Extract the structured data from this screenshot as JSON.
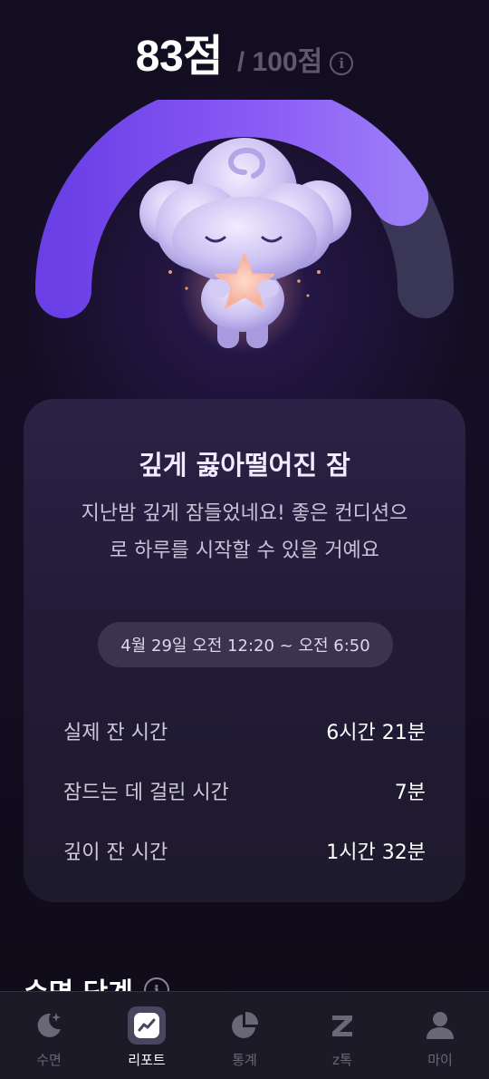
{
  "score": {
    "value": "83점",
    "max": "/ 100점",
    "score_fraction": 0.83
  },
  "card": {
    "title": "깊게 곯아떨어진 잠",
    "description": "지난밤 깊게 잠들었네요! 좋은 컨디션으로 하루를 시작할 수 있을 거예요",
    "time_range": "4월 29일 오전 12:20 ~ 오전 6:50",
    "stats": [
      {
        "label": "실제 잔 시간",
        "value": "6시간 21분"
      },
      {
        "label": "잠드는 데 걸린 시간",
        "value": "7분"
      },
      {
        "label": "깊이 잔 시간",
        "value": "1시간 32분"
      }
    ]
  },
  "section": {
    "title": "수면 단계"
  },
  "nav": [
    {
      "label": "수면",
      "icon": "moon-icon",
      "active": false
    },
    {
      "label": "리포트",
      "icon": "report-icon",
      "active": true
    },
    {
      "label": "통계",
      "icon": "pie-chart-icon",
      "active": false
    },
    {
      "label": "z톡",
      "icon": "z-icon",
      "active": false
    },
    {
      "label": "마이",
      "icon": "person-icon",
      "active": false
    }
  ],
  "colors": {
    "accent": "#7b4ff0",
    "gauge_track": "#3a3656",
    "background": "#0f0b18",
    "card": "#231c38"
  }
}
